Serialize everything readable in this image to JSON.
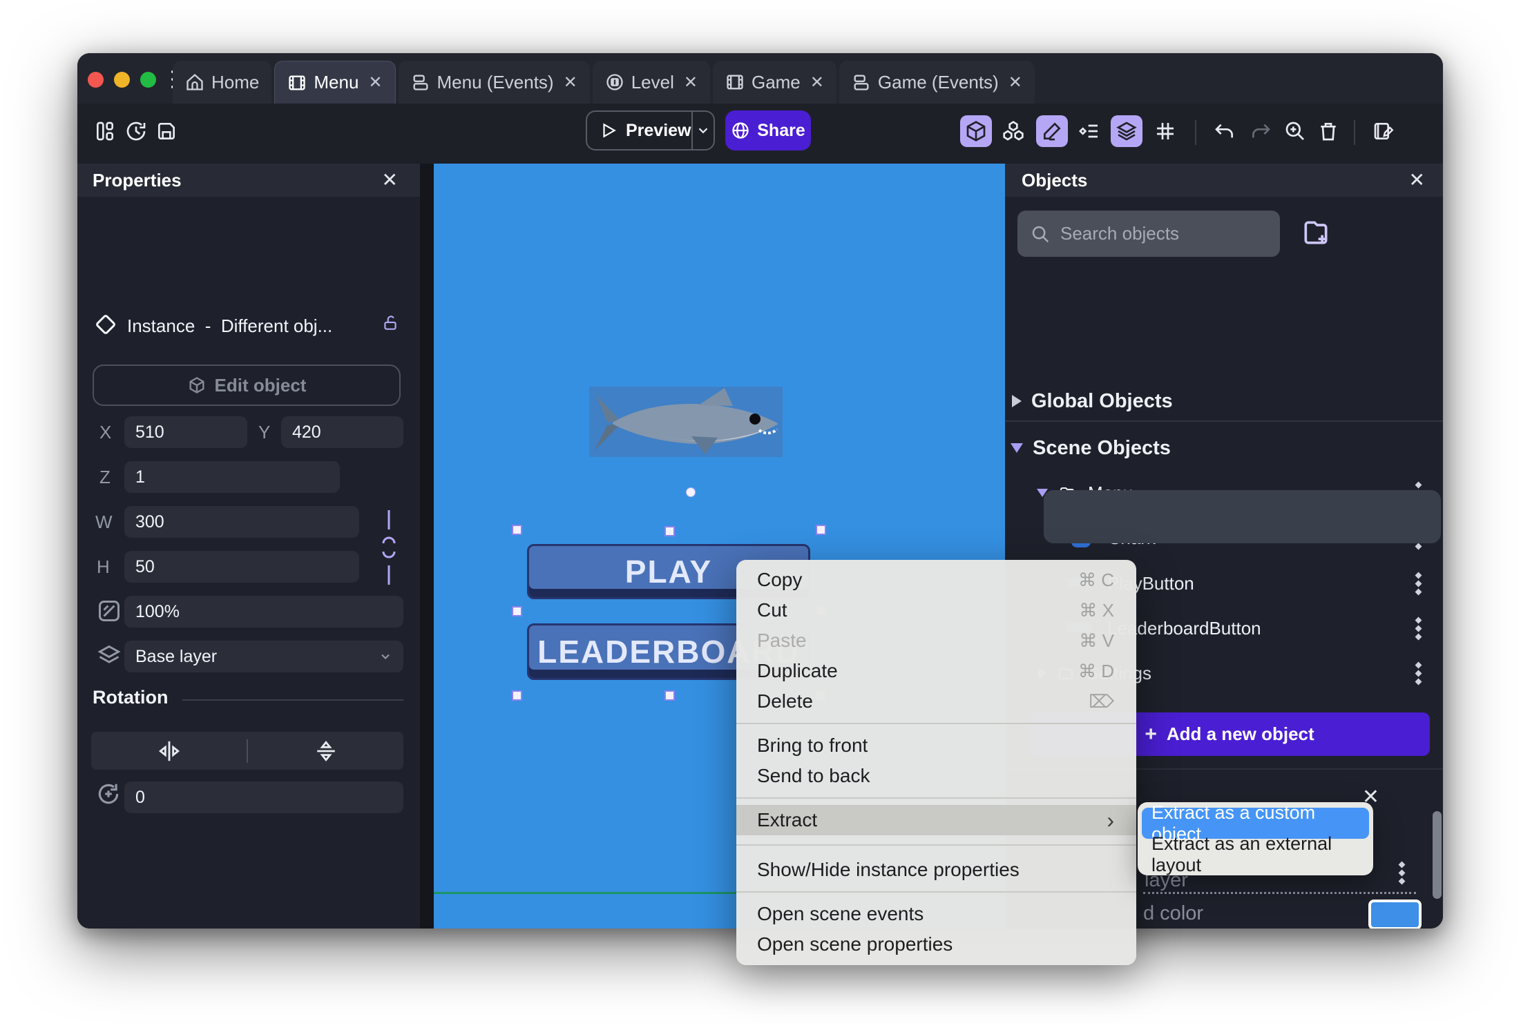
{
  "window": {
    "tabs": [
      {
        "label": "Home",
        "icon": "home",
        "active": false,
        "closable": false
      },
      {
        "label": "Menu",
        "icon": "scene",
        "active": true,
        "closable": true
      },
      {
        "label": "Menu (Events)",
        "icon": "events",
        "active": false,
        "closable": true
      },
      {
        "label": "Level",
        "icon": "level",
        "active": false,
        "closable": true
      },
      {
        "label": "Game",
        "icon": "scene",
        "active": false,
        "closable": true
      },
      {
        "label": "Game (Events)",
        "icon": "events",
        "active": false,
        "closable": true
      }
    ],
    "close_glyph": "✕"
  },
  "toolbar": {
    "preview_label": "Preview",
    "share_label": "Share"
  },
  "properties": {
    "title": "Properties",
    "instance_label": "Instance",
    "separator": "-",
    "instance_object": "Different obj...",
    "edit_object_label": "Edit object",
    "x_label": "X",
    "x_value": "510",
    "y_label": "Y",
    "y_value": "420",
    "z_label": "Z",
    "z_value": "1",
    "w_label": "W",
    "w_value": "300",
    "h_label": "H",
    "h_value": "50",
    "opacity_value": "100%",
    "layer_value": "Base layer",
    "rotation_title": "Rotation",
    "rotation_value": "0"
  },
  "scene": {
    "play_label": "PLAY",
    "leaderboard_label": "LEADERBOARD"
  },
  "objects": {
    "title": "Objects",
    "search_placeholder": "Search objects",
    "global_label": "Global Objects",
    "scene_label": "Scene Objects",
    "menu_folder": "Menu",
    "shark": "Shark",
    "play_button": "PlayButton",
    "leaderboard_button": "LeaderboardButton",
    "settings_folder": "Settings",
    "add_button_plus": "+",
    "add_button_label": "Add a new object",
    "bottom_layer_fragment": "layer",
    "bottom_color_fragment": "d color"
  },
  "context_menu": {
    "items": [
      {
        "label": "Copy",
        "shortcut": "⌘ C"
      },
      {
        "label": "Cut",
        "shortcut": "⌘ X"
      },
      {
        "label": "Paste",
        "shortcut": "⌘ V",
        "disabled": true
      },
      {
        "label": "Duplicate",
        "shortcut": "⌘ D"
      },
      {
        "label": "Delete",
        "shortcut": "⌦"
      },
      {
        "label": "Bring to front"
      },
      {
        "label": "Send to back"
      },
      {
        "label": "Extract",
        "chevron": "›"
      },
      {
        "label": "Show/Hide instance properties"
      },
      {
        "label": "Open scene events"
      },
      {
        "label": "Open scene properties"
      }
    ],
    "submenu": [
      {
        "label": "Extract as a custom object",
        "selected": true
      },
      {
        "label": "Extract as an external layout",
        "selected": false
      }
    ]
  },
  "colors": {
    "accent_purple": "#4a1ed2",
    "icon_highlight": "#b6a7f6",
    "canvas_blue": "#3590e2",
    "selection_blue": "#4695f6",
    "scene_guide_green": "#1c9464"
  }
}
